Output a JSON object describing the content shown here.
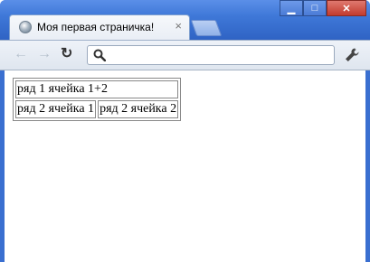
{
  "window": {
    "minimize": "▁",
    "maximize": "□",
    "close": "✕"
  },
  "tab": {
    "title": "Моя первая страничка!",
    "close": "×",
    "icon": "globe-icon"
  },
  "toolbar": {
    "back": "←",
    "forward": "→",
    "reload": "↻",
    "omnibox_value": "",
    "search_icon": "search-icon",
    "menu_icon": "wrench-icon"
  },
  "page": {
    "table": {
      "row1": {
        "cell_merged": "ряд 1 ячейка 1+2"
      },
      "row2": {
        "cell1": "ряд 2 ячейка 1",
        "cell2": "ряд 2 ячейка 2"
      }
    }
  }
}
